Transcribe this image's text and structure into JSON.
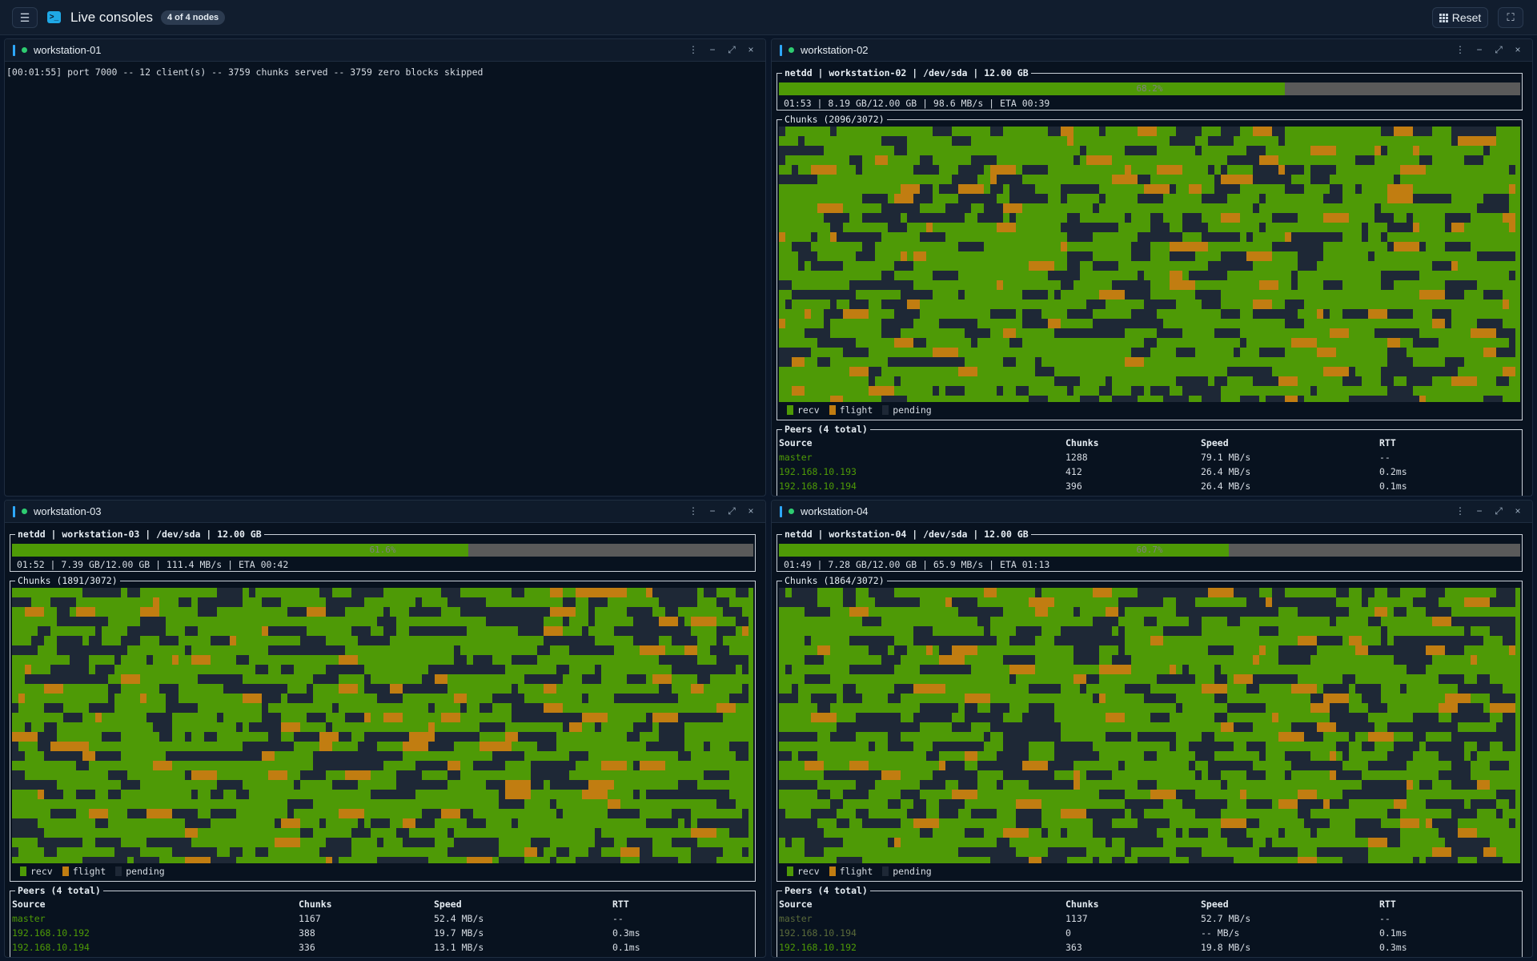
{
  "header": {
    "title": "Live consoles",
    "badge": "4 of 4 nodes",
    "reset_label": "Reset"
  },
  "colors": {
    "recv": "#4e9a06",
    "flight": "#c17d11",
    "pending": "#1e2836",
    "accent": "#2ea8ff",
    "status_ok": "#2ecc71"
  },
  "panels": [
    {
      "name": "workstation-01",
      "log": "[00:01:55] port 7000 -- 12 client(s) -- 3759 chunks served -- 3759 zero blocks skipped"
    },
    {
      "name": "workstation-02",
      "title": "netdd | workstation-02 | /dev/sda | 12.00 GB",
      "progress": 68.2,
      "progress_label": "68.2%",
      "stat": "01:53 | 8.19 GB/12.00 GB | 98.6 MB/s | ETA 00:39",
      "chunks_title": "Chunks (2096/3072)",
      "chunks_recv": 2096,
      "chunks_total": 3072,
      "legend": {
        "recv": "recv",
        "flight": "flight",
        "pending": "pending"
      },
      "peers_title": "Peers (4 total)",
      "peers_cols": {
        "source": "Source",
        "chunks": "Chunks",
        "speed": "Speed",
        "rtt": "RTT"
      },
      "peers": [
        {
          "source": "master",
          "chunks": "1288",
          "speed": "79.1 MB/s",
          "rtt": "--",
          "active": true
        },
        {
          "source": "192.168.10.193",
          "chunks": "412",
          "speed": "26.4 MB/s",
          "rtt": "0.2ms",
          "active": true
        },
        {
          "source": "192.168.10.194",
          "chunks": "396",
          "speed": "26.4 MB/s",
          "rtt": "0.1ms",
          "active": true
        }
      ]
    },
    {
      "name": "workstation-03",
      "title": "netdd | workstation-03 | /dev/sda | 12.00 GB",
      "progress": 61.6,
      "progress_label": "61.6%",
      "stat": "01:52 | 7.39 GB/12.00 GB | 111.4 MB/s | ETA 00:42",
      "chunks_title": "Chunks (1891/3072)",
      "chunks_recv": 1891,
      "chunks_total": 3072,
      "legend": {
        "recv": "recv",
        "flight": "flight",
        "pending": "pending"
      },
      "peers_title": "Peers (4 total)",
      "peers_cols": {
        "source": "Source",
        "chunks": "Chunks",
        "speed": "Speed",
        "rtt": "RTT"
      },
      "peers": [
        {
          "source": "master",
          "chunks": "1167",
          "speed": "52.4 MB/s",
          "rtt": "--",
          "active": true
        },
        {
          "source": "192.168.10.192",
          "chunks": "388",
          "speed": "19.7 MB/s",
          "rtt": "0.3ms",
          "active": true
        },
        {
          "source": "192.168.10.194",
          "chunks": "336",
          "speed": "13.1 MB/s",
          "rtt": "0.1ms",
          "active": true
        }
      ]
    },
    {
      "name": "workstation-04",
      "title": "netdd | workstation-04 | /dev/sda | 12.00 GB",
      "progress": 60.7,
      "progress_label": "60.7%",
      "stat": "01:49 | 7.28 GB/12.00 GB | 65.9 MB/s | ETA 01:13",
      "chunks_title": "Chunks (1864/3072)",
      "chunks_recv": 1864,
      "chunks_total": 3072,
      "legend": {
        "recv": "recv",
        "flight": "flight",
        "pending": "pending"
      },
      "peers_title": "Peers (4 total)",
      "peers_cols": {
        "source": "Source",
        "chunks": "Chunks",
        "speed": "Speed",
        "rtt": "RTT"
      },
      "peers": [
        {
          "source": "master",
          "chunks": "1137",
          "speed": "52.7 MB/s",
          "rtt": "--",
          "active": false
        },
        {
          "source": "192.168.10.194",
          "chunks": "0",
          "speed": "-- MB/s",
          "rtt": "0.1ms",
          "active": false
        },
        {
          "source": "192.168.10.192",
          "chunks": "363",
          "speed": "19.8 MB/s",
          "rtt": "0.3ms",
          "active": true
        }
      ]
    }
  ]
}
